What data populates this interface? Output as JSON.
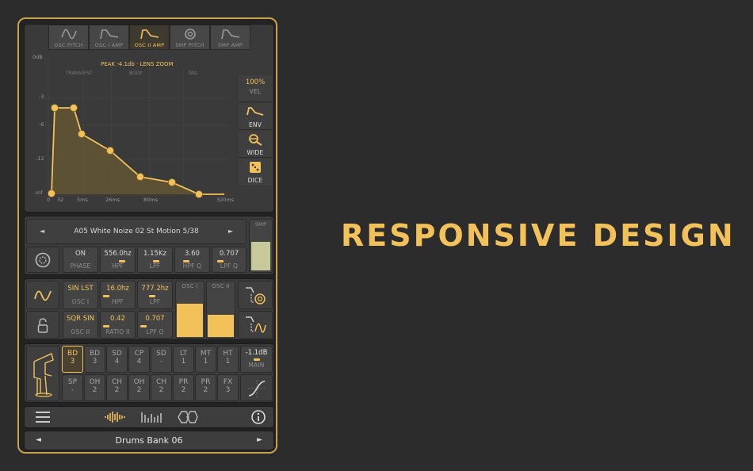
{
  "tagline": "RESPONSIVE DESIGN",
  "tabs": [
    {
      "label": "OSC PITCH",
      "icon": "osc-pitch-icon",
      "active": false
    },
    {
      "label": "OSC I AMP",
      "icon": "osc-i-amp-icon",
      "active": false
    },
    {
      "label": "OSC II AMP",
      "icon": "osc-ii-amp-icon",
      "active": true
    },
    {
      "label": "SMP PITCH",
      "icon": "smp-pitch-icon",
      "active": false
    },
    {
      "label": "SMP AMP",
      "icon": "smp-amp-icon",
      "active": false
    }
  ],
  "graph": {
    "header": "PEAK -4.1db · LENS ZOOM",
    "sections": [
      "TRANSIENT",
      "BODY",
      "TAIL"
    ],
    "y_labels": [
      "0dB",
      "-3",
      "-6",
      "-12",
      "-inf"
    ],
    "x_labels": [
      "0",
      "32",
      "5ms",
      "26ms",
      "80ms",
      "320ms"
    ]
  },
  "side": {
    "vel_value": "100%",
    "vel_label": "VEL",
    "env_label": "ENV",
    "wide_label": "WIDE",
    "dice_label": "DICE"
  },
  "sample": {
    "name": "A05 White Noize 02 St Motion 5/38",
    "smp_label": "SMP",
    "params": [
      {
        "value": "ON",
        "label": "PHASE"
      },
      {
        "value": "556.0hz",
        "label": "HPF"
      },
      {
        "value": "1.15Kz",
        "label": "LPF"
      },
      {
        "value": "3.60",
        "label": "HPF Q"
      },
      {
        "value": "0.707",
        "label": "LPF Q"
      }
    ]
  },
  "osc": {
    "row1": [
      {
        "value": "SIN LST",
        "label": "OSC I"
      },
      {
        "value": "16.0hz",
        "label": "HPF"
      },
      {
        "value": "777.2hz",
        "label": "LPF"
      }
    ],
    "row2": [
      {
        "value": "SQR SIN",
        "label": "OSC II"
      },
      {
        "value": "0.42",
        "label": "RATIO II"
      },
      {
        "value": "0.707",
        "label": "LPF Q"
      }
    ],
    "meter1_label": "OSC I",
    "meter2_label": "OSC II"
  },
  "pads": {
    "row1": [
      {
        "name": "BD",
        "num": "3",
        "active": true
      },
      {
        "name": "BD",
        "num": "3"
      },
      {
        "name": "SD",
        "num": "4"
      },
      {
        "name": "CP",
        "num": "4"
      },
      {
        "name": "SD",
        "num": "-"
      },
      {
        "name": "LT",
        "num": "1"
      },
      {
        "name": "MT",
        "num": "1"
      },
      {
        "name": "HT",
        "num": "1"
      }
    ],
    "row2": [
      {
        "name": "SP",
        "num": "-"
      },
      {
        "name": "OH",
        "num": "2"
      },
      {
        "name": "CH",
        "num": "2"
      },
      {
        "name": "OH",
        "num": "2"
      },
      {
        "name": "CH",
        "num": "2"
      },
      {
        "name": "PR",
        "num": "2"
      },
      {
        "name": "PR",
        "num": "2"
      },
      {
        "name": "FX",
        "num": "3"
      }
    ],
    "main_value": "-1.1dB",
    "main_label": "MAIN"
  },
  "bank": {
    "name": "Drums Bank 06",
    "prev": "◄",
    "next": "►"
  },
  "sample_nav": {
    "prev": "◄",
    "next": "►"
  },
  "colors": {
    "accent": "#f2c15a",
    "frame": "#c9a24e",
    "background": "#2c2c2c"
  }
}
